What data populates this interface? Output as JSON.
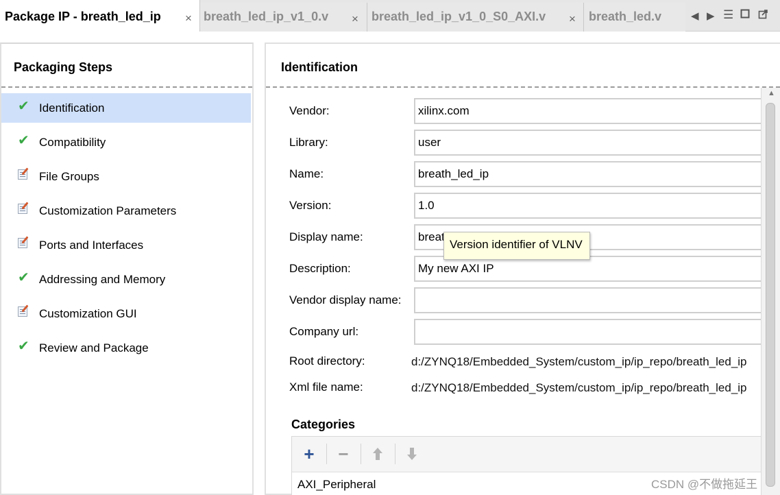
{
  "tabs": [
    {
      "label": "Package IP - breath_led_ip",
      "active": true
    },
    {
      "label": "breath_led_ip_v1_0.v",
      "active": false
    },
    {
      "label": "breath_led_ip_v1_0_S0_AXI.v",
      "active": false
    },
    {
      "label": "breath_led.v",
      "active": false
    }
  ],
  "tab_close_glyph": "×",
  "tab_controls": [
    "chevron-left-icon",
    "chevron-right-icon",
    "list-menu-icon",
    "maximize-icon",
    "restore-icon"
  ],
  "left_pane": {
    "title": "Packaging Steps",
    "steps": [
      {
        "label": "Identification",
        "icon": "check-icon",
        "selected": true
      },
      {
        "label": "Compatibility",
        "icon": "check-icon",
        "selected": false
      },
      {
        "label": "File Groups",
        "icon": "edit-icon",
        "selected": false
      },
      {
        "label": "Customization Parameters",
        "icon": "edit-icon",
        "selected": false
      },
      {
        "label": "Ports and Interfaces",
        "icon": "edit-icon",
        "selected": false
      },
      {
        "label": "Addressing and Memory",
        "icon": "check-icon",
        "selected": false
      },
      {
        "label": "Customization GUI",
        "icon": "edit-icon",
        "selected": false
      },
      {
        "label": "Review and Package",
        "icon": "check-icon",
        "selected": false
      }
    ]
  },
  "identification": {
    "title": "Identification",
    "fields": [
      {
        "label": "Vendor:",
        "value": "xilinx.com"
      },
      {
        "label": "Library:",
        "value": "user"
      },
      {
        "label": "Name:",
        "value": "breath_led_ip"
      },
      {
        "label": "Version:",
        "value": "1.0"
      },
      {
        "label": "Display name:",
        "value": "breat"
      },
      {
        "label": "Description:",
        "value": "My new AXI IP"
      },
      {
        "label": "Vendor display name:",
        "value": ""
      },
      {
        "label": "Company url:",
        "value": ""
      }
    ],
    "root_directory": {
      "label": "Root directory:",
      "value": "d:/ZYNQ18/Embedded_System/custom_ip/ip_repo/breath_led_ip"
    },
    "xml_file_name": {
      "label": "Xml file name:",
      "value": "d:/ZYNQ18/Embedded_System/custom_ip/ip_repo/breath_led_ip"
    },
    "tooltip": "Version identifier of VLNV"
  },
  "categories": {
    "title": "Categories",
    "toolbar": [
      "add-icon",
      "remove-icon",
      "move-up-icon",
      "move-down-icon"
    ],
    "items": [
      "AXI_Peripheral"
    ]
  },
  "watermark": "CSDN @不做拖延王",
  "colors": {
    "check": "#39a845",
    "selected_row": "#cfe0fa",
    "tooltip_bg": "#ffffe1",
    "add_icon": "#2f5597"
  }
}
